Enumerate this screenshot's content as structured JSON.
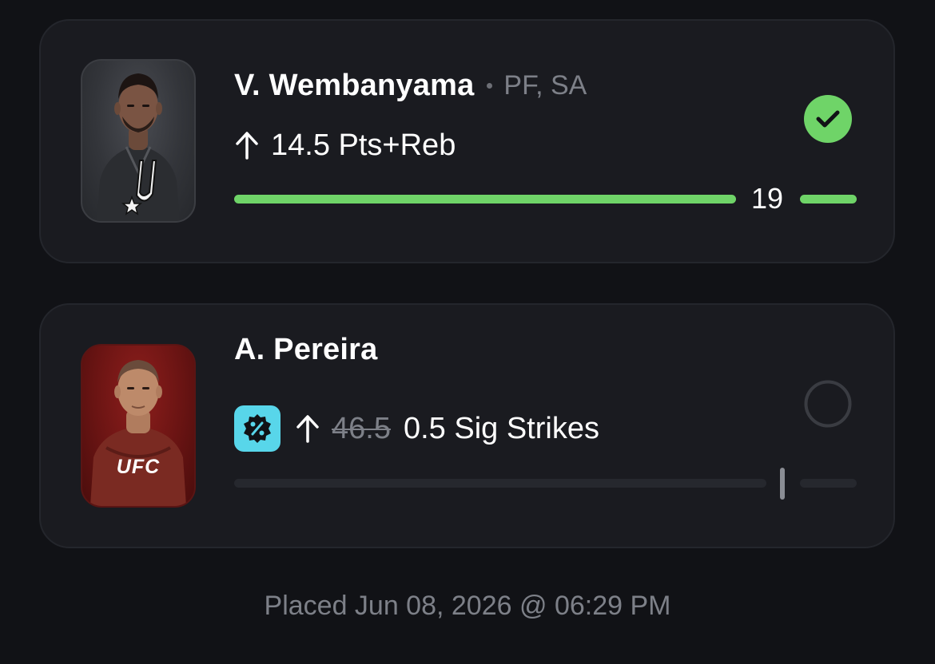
{
  "picks": [
    {
      "player_name": "V. Wembanyama",
      "position_team": "PF, SA",
      "direction_icon": "arrow-up-icon",
      "line": "14.5 Pts+Reb",
      "status": "hit",
      "status_icon": "check-circle-icon",
      "status_color": "#6fd468",
      "current_value": "19",
      "progress_fraction": 1.0,
      "team_logo_icon": "spurs-logo-icon"
    },
    {
      "player_name": "A. Pereira",
      "promo_icon": "discount-badge-icon",
      "promo_color": "#58d6ea",
      "direction_icon": "arrow-up-icon",
      "original_line": "46.5",
      "line": "0.5 Sig Strikes",
      "status": "pending",
      "status_icon": "empty-circle-icon",
      "progress_fraction": 0.0,
      "league_logo_text": "UFC"
    }
  ],
  "placed_text": "Placed Jun 08, 2026 @ 06:29 PM",
  "colors": {
    "background": "#111216",
    "card": "#1a1b20",
    "accent_green": "#6fd468",
    "muted_text": "#7d8088"
  }
}
